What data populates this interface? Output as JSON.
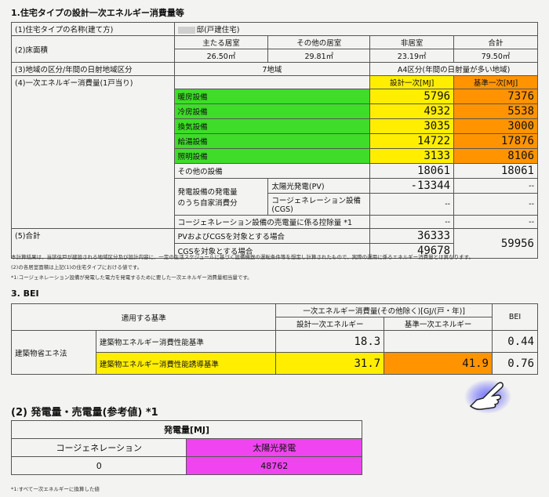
{
  "section1": {
    "title": "1.住宅タイプの設計一次エネルギー消費量等",
    "row1_label": "(1)住宅タイプの名称(建て方)",
    "row1_value": "邸(戸建住宅)",
    "row2_label": "(2)床面積",
    "area_headers": [
      "主たる居室",
      "その他の居室",
      "非居室",
      "合計"
    ],
    "area_values": [
      "26.50㎡",
      "29.81㎡",
      "23.19㎡",
      "79.50㎡"
    ],
    "row3_label": "(3)地域の区分/年間の日射地域区分",
    "row3_region": "7地域",
    "row3_solar": "A4区分(年間の日射量が多い地域)",
    "row4_label": "(4)一次エネルギー消費量(1戸当り)",
    "col_design": "設計一次[MJ]",
    "col_standard": "基準一次[MJ]",
    "equipment": [
      {
        "name": "暖房設備",
        "design": "5796",
        "standard": "7376"
      },
      {
        "name": "冷房設備",
        "design": "4932",
        "standard": "5538"
      },
      {
        "name": "換気設備",
        "design": "3035",
        "standard": "3000"
      },
      {
        "name": "給湯設備",
        "design": "14722",
        "standard": "17876"
      },
      {
        "name": "照明設備",
        "design": "3133",
        "standard": "8106"
      }
    ],
    "other_label": "その他の設備",
    "other_design": "18061",
    "other_standard": "18061",
    "gen_label_1": "発電設備の発電量",
    "gen_label_2": "のうち自家消費分",
    "pv_label": "太陽光発電(PV)",
    "pv_design": "-13344",
    "pv_standard": "--",
    "cgs_label": "コージェネレーション設備(CGS)",
    "cgs_design": "--",
    "cgs_standard": "--",
    "deduct_label": "コージェネレーション設備の売電量に係る控除量 *1",
    "deduct_design": "--",
    "deduct_standard": "--",
    "row5_label": "(5)合計",
    "total_pv_cgs_label": "PVおよびCGSを対象とする場合",
    "total_pv_cgs": "36333",
    "total_cgs_label": "CGSを対象とする場合",
    "total_cgs": "49678",
    "total_standard": "59956",
    "note1": "本計算結果は、当該住戸が建設される地域区分及び設計内容に、一定の生活スケジュールに基づく設備機器の運転条件等を想定し計算されたもので、実際の運用に係るエネルギー消費量とは異なります。",
    "note2": "(2)の各居室面積は上記(1)の住宅タイプにおける値です。",
    "note3": "*1:コージェネレーション設備が発電した電力を発電するために要した一次エネルギー消費量相当量です。"
  },
  "section3": {
    "title": "3. BEI",
    "header_applied": "適用する基準",
    "header_energy": "一次エネルギー消費量(その他除く)[GJ/(戸・年)]",
    "header_design": "設計一次エネルギー",
    "header_standard": "基準一次エネルギー",
    "header_bei": "BEI",
    "law_label": "建築物省エネ法",
    "rows": [
      {
        "name": "建築物エネルギー消費性能基準",
        "design": "18.3",
        "standard": "",
        "bei": "0.44"
      },
      {
        "name": "建築物エネルギー消費性能誘導基準",
        "design": "31.7",
        "standard": "41.9",
        "bei": "0.76"
      }
    ]
  },
  "section2": {
    "title": "(2) 発電量・売電量(参考値) *1",
    "header": "発電量[MJ]",
    "col_cgs": "コージェネレーション",
    "col_pv": "太陽光発電",
    "val_cgs": "0",
    "val_pv": "48762",
    "note": "*1:すべて一次エネルギーに換算した値"
  }
}
